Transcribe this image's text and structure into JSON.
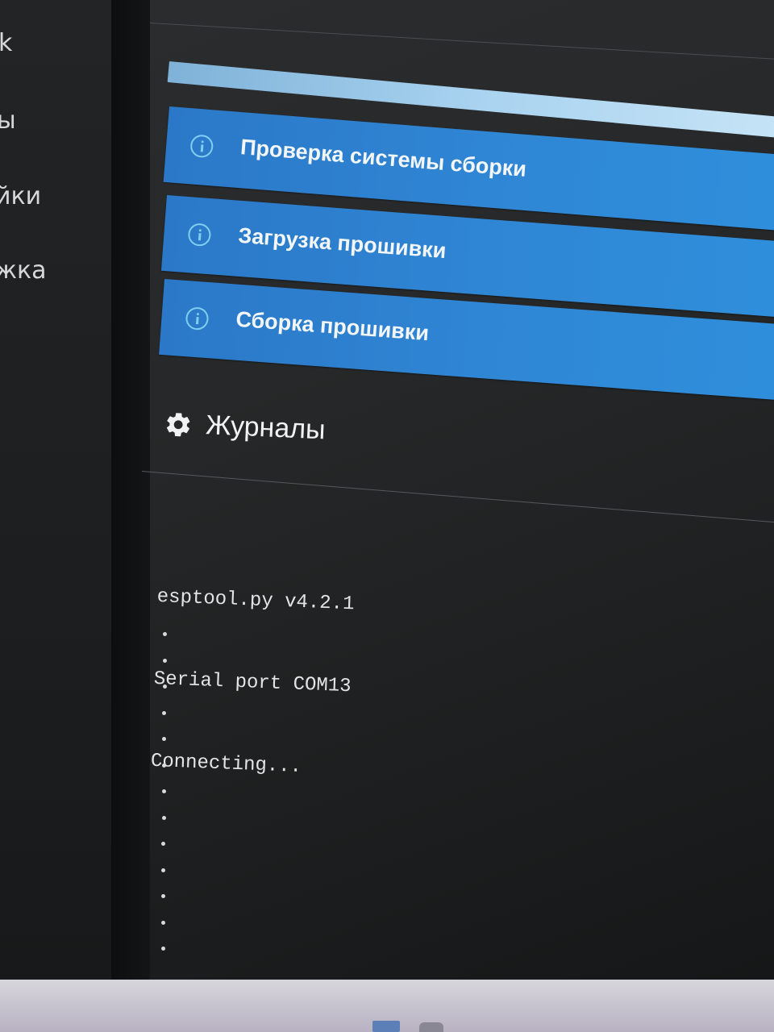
{
  "sidebar": {
    "items": [
      {
        "label": "k"
      },
      {
        "label": "ы"
      },
      {
        "label": "йки"
      },
      {
        "label": "жка"
      }
    ]
  },
  "status_items": [
    {
      "label": "Проверка системы сборки",
      "icon": "info-icon"
    },
    {
      "label": "Загрузка прошивки",
      "icon": "info-icon"
    },
    {
      "label": "Сборка прошивки",
      "icon": "info-icon"
    }
  ],
  "logs": {
    "title": "Журналы",
    "icon": "gear-icon",
    "lines": [
      "esptool.py v4.2.1",
      "Serial port COM13",
      "Connecting..."
    ],
    "progress_dots_visible": 13
  },
  "colors": {
    "status_bg": "#2f86d4",
    "info_icon": "#7fd0f0",
    "panel_bg": "#262829",
    "text_light": "#f0f2f4"
  }
}
